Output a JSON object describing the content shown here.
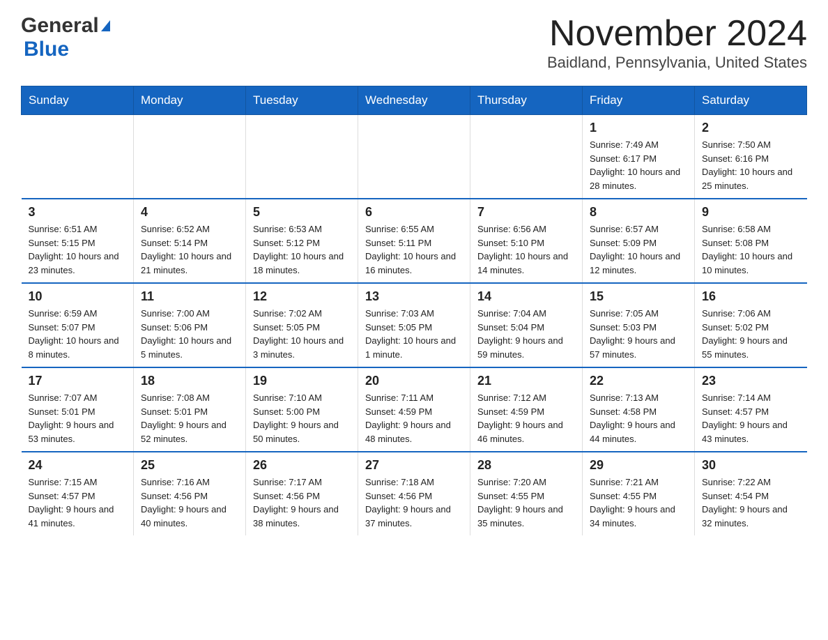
{
  "logo": {
    "general": "General",
    "blue": "Blue"
  },
  "title": "November 2024",
  "subtitle": "Baidland, Pennsylvania, United States",
  "weekdays": [
    "Sunday",
    "Monday",
    "Tuesday",
    "Wednesday",
    "Thursday",
    "Friday",
    "Saturday"
  ],
  "weeks": [
    [
      {
        "day": "",
        "info": ""
      },
      {
        "day": "",
        "info": ""
      },
      {
        "day": "",
        "info": ""
      },
      {
        "day": "",
        "info": ""
      },
      {
        "day": "",
        "info": ""
      },
      {
        "day": "1",
        "info": "Sunrise: 7:49 AM\nSunset: 6:17 PM\nDaylight: 10 hours and 28 minutes."
      },
      {
        "day": "2",
        "info": "Sunrise: 7:50 AM\nSunset: 6:16 PM\nDaylight: 10 hours and 25 minutes."
      }
    ],
    [
      {
        "day": "3",
        "info": "Sunrise: 6:51 AM\nSunset: 5:15 PM\nDaylight: 10 hours and 23 minutes."
      },
      {
        "day": "4",
        "info": "Sunrise: 6:52 AM\nSunset: 5:14 PM\nDaylight: 10 hours and 21 minutes."
      },
      {
        "day": "5",
        "info": "Sunrise: 6:53 AM\nSunset: 5:12 PM\nDaylight: 10 hours and 18 minutes."
      },
      {
        "day": "6",
        "info": "Sunrise: 6:55 AM\nSunset: 5:11 PM\nDaylight: 10 hours and 16 minutes."
      },
      {
        "day": "7",
        "info": "Sunrise: 6:56 AM\nSunset: 5:10 PM\nDaylight: 10 hours and 14 minutes."
      },
      {
        "day": "8",
        "info": "Sunrise: 6:57 AM\nSunset: 5:09 PM\nDaylight: 10 hours and 12 minutes."
      },
      {
        "day": "9",
        "info": "Sunrise: 6:58 AM\nSunset: 5:08 PM\nDaylight: 10 hours and 10 minutes."
      }
    ],
    [
      {
        "day": "10",
        "info": "Sunrise: 6:59 AM\nSunset: 5:07 PM\nDaylight: 10 hours and 8 minutes."
      },
      {
        "day": "11",
        "info": "Sunrise: 7:00 AM\nSunset: 5:06 PM\nDaylight: 10 hours and 5 minutes."
      },
      {
        "day": "12",
        "info": "Sunrise: 7:02 AM\nSunset: 5:05 PM\nDaylight: 10 hours and 3 minutes."
      },
      {
        "day": "13",
        "info": "Sunrise: 7:03 AM\nSunset: 5:05 PM\nDaylight: 10 hours and 1 minute."
      },
      {
        "day": "14",
        "info": "Sunrise: 7:04 AM\nSunset: 5:04 PM\nDaylight: 9 hours and 59 minutes."
      },
      {
        "day": "15",
        "info": "Sunrise: 7:05 AM\nSunset: 5:03 PM\nDaylight: 9 hours and 57 minutes."
      },
      {
        "day": "16",
        "info": "Sunrise: 7:06 AM\nSunset: 5:02 PM\nDaylight: 9 hours and 55 minutes."
      }
    ],
    [
      {
        "day": "17",
        "info": "Sunrise: 7:07 AM\nSunset: 5:01 PM\nDaylight: 9 hours and 53 minutes."
      },
      {
        "day": "18",
        "info": "Sunrise: 7:08 AM\nSunset: 5:01 PM\nDaylight: 9 hours and 52 minutes."
      },
      {
        "day": "19",
        "info": "Sunrise: 7:10 AM\nSunset: 5:00 PM\nDaylight: 9 hours and 50 minutes."
      },
      {
        "day": "20",
        "info": "Sunrise: 7:11 AM\nSunset: 4:59 PM\nDaylight: 9 hours and 48 minutes."
      },
      {
        "day": "21",
        "info": "Sunrise: 7:12 AM\nSunset: 4:59 PM\nDaylight: 9 hours and 46 minutes."
      },
      {
        "day": "22",
        "info": "Sunrise: 7:13 AM\nSunset: 4:58 PM\nDaylight: 9 hours and 44 minutes."
      },
      {
        "day": "23",
        "info": "Sunrise: 7:14 AM\nSunset: 4:57 PM\nDaylight: 9 hours and 43 minutes."
      }
    ],
    [
      {
        "day": "24",
        "info": "Sunrise: 7:15 AM\nSunset: 4:57 PM\nDaylight: 9 hours and 41 minutes."
      },
      {
        "day": "25",
        "info": "Sunrise: 7:16 AM\nSunset: 4:56 PM\nDaylight: 9 hours and 40 minutes."
      },
      {
        "day": "26",
        "info": "Sunrise: 7:17 AM\nSunset: 4:56 PM\nDaylight: 9 hours and 38 minutes."
      },
      {
        "day": "27",
        "info": "Sunrise: 7:18 AM\nSunset: 4:56 PM\nDaylight: 9 hours and 37 minutes."
      },
      {
        "day": "28",
        "info": "Sunrise: 7:20 AM\nSunset: 4:55 PM\nDaylight: 9 hours and 35 minutes."
      },
      {
        "day": "29",
        "info": "Sunrise: 7:21 AM\nSunset: 4:55 PM\nDaylight: 9 hours and 34 minutes."
      },
      {
        "day": "30",
        "info": "Sunrise: 7:22 AM\nSunset: 4:54 PM\nDaylight: 9 hours and 32 minutes."
      }
    ]
  ]
}
